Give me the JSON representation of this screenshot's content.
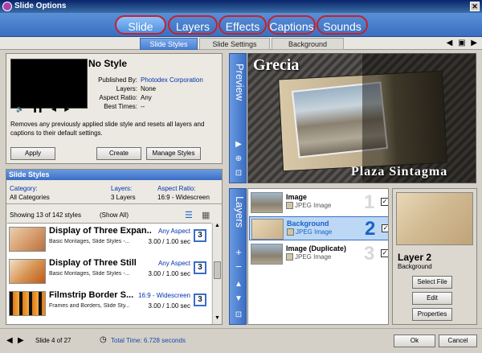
{
  "window": {
    "title": "Slide Options"
  },
  "main_tabs": [
    {
      "label": "Slide",
      "active": true
    },
    {
      "label": "Layers",
      "active": false
    },
    {
      "label": "Effects",
      "active": false
    },
    {
      "label": "Captions",
      "active": false
    },
    {
      "label": "Sounds",
      "active": false
    }
  ],
  "sub_tabs": [
    {
      "label": "Slide Styles",
      "active": true
    },
    {
      "label": "Slide Settings",
      "active": false
    },
    {
      "label": "Background",
      "active": false
    }
  ],
  "style_info": {
    "name": "No Style",
    "published_by_label": "Published By:",
    "published_by": "Photodex Corporation",
    "layers_label": "Layers:",
    "layers": "None",
    "aspect_ratio_label": "Aspect Ratio:",
    "aspect_ratio": "Any",
    "best_times_label": "Best Times:",
    "best_times": "--",
    "description": "Removes any previously applied slide style and resets all layers and captions to their default settings.",
    "buttons": {
      "apply": "Apply",
      "create": "Create",
      "manage": "Manage Styles"
    }
  },
  "slide_styles": {
    "header": "Slide Styles",
    "category_label": "Category:",
    "category": "All Categories",
    "layers_label": "Layers:",
    "layers": "3 Layers",
    "aspect_label": "Aspect Ratio:",
    "aspect": "16:9 - Widescreen",
    "showing": "Showing 13 of 142 styles",
    "show_all": "(Show All)",
    "items": [
      {
        "title": "Display of Three Expan...",
        "aspect": "Any Aspect",
        "subtitle": "Basic Montages, Slide Styles -...",
        "ratio": "3.00 / 1.00 sec",
        "layers": "3"
      },
      {
        "title": "Display of Three Still",
        "aspect": "Any Aspect",
        "subtitle": "Basic Montages, Slide Styles -...",
        "ratio": "3.00 / 1.00 sec",
        "layers": "3"
      },
      {
        "title": "Filmstrip Border S...",
        "aspect": "16:9 - Widescreen",
        "subtitle": "Frames and Borders, Slide Sty...",
        "ratio": "3.00 / 1.00 sec",
        "layers": "3"
      }
    ]
  },
  "preview": {
    "label": "Preview",
    "caption_top": "Grecia",
    "caption_bottom": "Plaza Sintagma"
  },
  "layers_panel": {
    "label": "Layers",
    "rows": [
      {
        "name": "Image",
        "type": "JPEG Image",
        "num": "1",
        "checked": "✓"
      },
      {
        "name": "Background",
        "type": "JPEG Image",
        "num": "2",
        "checked": "✓"
      },
      {
        "name": "Image (Duplicate)",
        "type": "JPEG Image",
        "num": "3",
        "checked": "✓"
      }
    ],
    "selected": {
      "title": "Layer 2",
      "subtitle": "Background"
    },
    "buttons": {
      "select_file": "Select File",
      "edit": "Edit",
      "properties": "Properties"
    }
  },
  "status": {
    "slide": "Slide 4 of 27",
    "total_time": "Total Time: 6.728 seconds",
    "ok": "Ok",
    "cancel": "Cancel"
  }
}
